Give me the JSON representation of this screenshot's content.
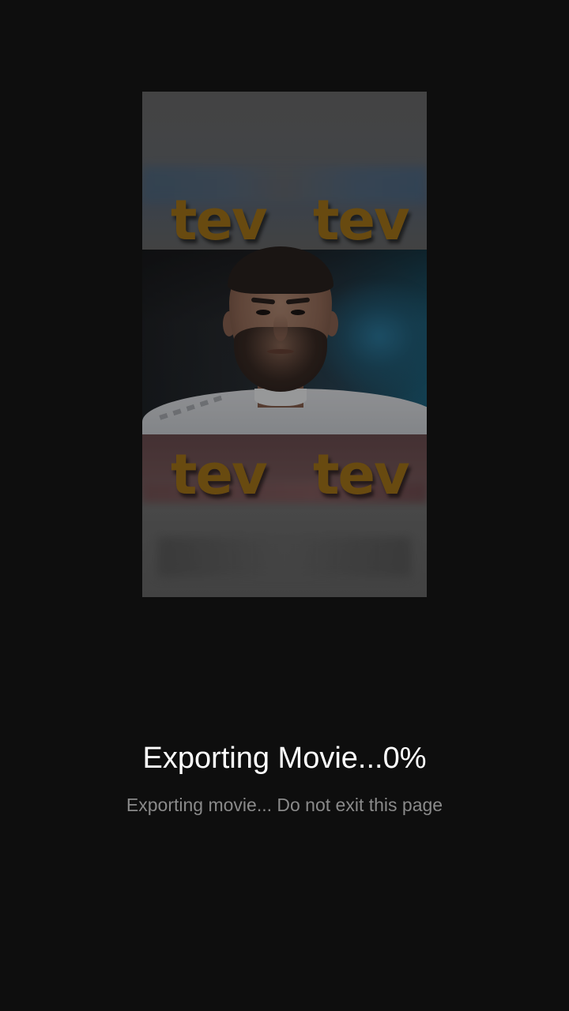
{
  "export": {
    "progress_percent": 0,
    "title": "Exporting Movie...0%",
    "message": "Exporting movie... Do not exit this page"
  },
  "preview": {
    "watermarks": [
      "tev",
      "tev",
      "tev",
      "tev"
    ]
  },
  "colors": {
    "background": "#0e0e0e",
    "title_text": "#ffffff",
    "message_text": "#8a8a8a",
    "watermark": "#a8781a"
  }
}
